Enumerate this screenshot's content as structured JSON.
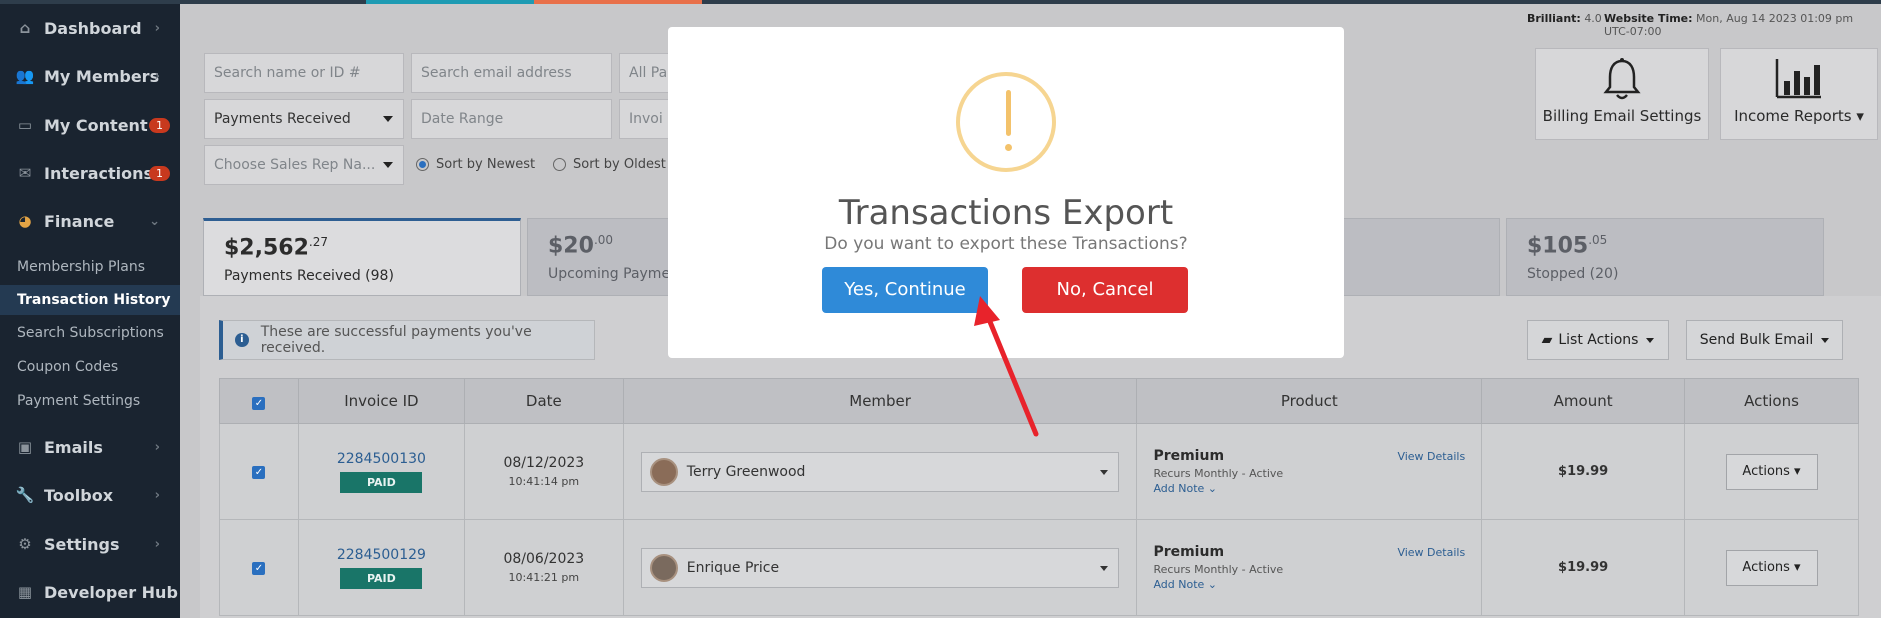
{
  "sidebar": {
    "items": [
      {
        "label": "Dashboard",
        "icon": "home-icon",
        "badge": ""
      },
      {
        "label": "My Members",
        "icon": "users-icon",
        "badge": ""
      },
      {
        "label": "My Content",
        "icon": "folder-icon",
        "badge": "1"
      },
      {
        "label": "Interactions",
        "icon": "comments-icon",
        "badge": "1"
      },
      {
        "label": "Finance",
        "icon": "pie-chart-icon",
        "badge": ""
      }
    ],
    "finance_sub": [
      {
        "label": "Membership Plans"
      },
      {
        "label": "Transaction History",
        "active": true
      },
      {
        "label": "Search Subscriptions"
      },
      {
        "label": "Coupon Codes"
      },
      {
        "label": "Payment Settings"
      }
    ],
    "lower_items": [
      {
        "label": "Emails",
        "icon": "inbox-icon"
      },
      {
        "label": "Toolbox",
        "icon": "wrench-icon"
      },
      {
        "label": "Settings",
        "icon": "gear-icon"
      },
      {
        "label": "Developer Hub",
        "icon": "grid-icon"
      }
    ]
  },
  "header": {
    "brilliant_label": "Brilliant:",
    "brilliant_value": "4.0",
    "time_label": "Website Time:",
    "time_value": "Mon, Aug 14 2023 01:09 pm UTC-07:00"
  },
  "filters": {
    "search_name_placeholder": "Search name or ID #",
    "search_email_placeholder": "Search email address",
    "all_pa": "All Pa",
    "payments_received": "Payments Received",
    "date_range_placeholder": "Date Range",
    "invoice_partial": "Invoi",
    "sales_rep_placeholder": "Choose Sales Rep Na...",
    "sort_newest": "Sort by Newest",
    "sort_oldest": "Sort by Oldest"
  },
  "top_buttons": {
    "billing": "Billing Email Settings",
    "income": "Income Reports"
  },
  "tabs": [
    {
      "amount": "$2,562",
      "cents": ".27",
      "label": "Payments Received (98)"
    },
    {
      "amount": "$20",
      "cents": ".00",
      "label": "Upcoming Payme"
    },
    {
      "amount": "$105",
      "cents": ".05",
      "label": "Stopped (20)"
    }
  ],
  "info_text": "These are successful payments you've received.",
  "list_actions": "List Actions",
  "send_bulk": "Send Bulk Email",
  "table": {
    "headers": [
      "Invoice ID",
      "Date",
      "Member",
      "Product",
      "Amount",
      "Actions"
    ],
    "rows": [
      {
        "invoice": "2284500130",
        "status": "PAID",
        "date": "08/12/2023",
        "time": "10:41:14 pm",
        "member": "Terry Greenwood",
        "product": "Premium",
        "recurs": "Recurs Monthly - Active",
        "add_note": "Add Note ⌄",
        "view": "View Details",
        "amount": "$19.99",
        "actions": "Actions"
      },
      {
        "invoice": "2284500129",
        "status": "PAID",
        "date": "08/06/2023",
        "time": "10:41:21 pm",
        "member": "Enrique Price",
        "product": "Premium",
        "recurs": "Recurs Monthly - Active",
        "add_note": "Add Note ⌄",
        "view": "View Details",
        "amount": "$19.99",
        "actions": "Actions"
      }
    ]
  },
  "modal": {
    "title": "Transactions Export",
    "question": "Do you want to export these Transactions?",
    "yes": "Yes, Continue",
    "no": "No, Cancel"
  }
}
